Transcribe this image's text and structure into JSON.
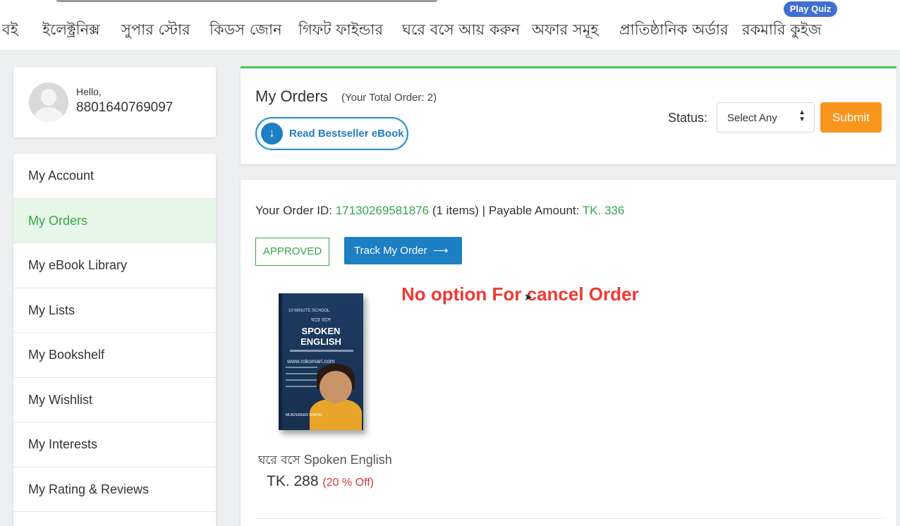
{
  "nav": {
    "items": [
      "বই",
      "ইলেক্ট্রনিক্স",
      "সুপার স্টোর",
      "কিডস জোন",
      "গিফট ফাইন্ডার",
      "ঘরে বসে আয় করুন",
      "অফার সমূহ",
      "প্রাতিষ্ঠানিক অর্ডার",
      "রকমারি কুইজ"
    ],
    "quiz_badge": "Play Quiz"
  },
  "profile": {
    "greeting": "Hello,",
    "phone": "8801640769097"
  },
  "sidebar": {
    "items": [
      {
        "label": "My Account",
        "active": false
      },
      {
        "label": "My Orders",
        "active": true
      },
      {
        "label": "My eBook Library",
        "active": false
      },
      {
        "label": "My Lists",
        "active": false
      },
      {
        "label": "My Bookshelf",
        "active": false
      },
      {
        "label": "My Wishlist",
        "active": false
      },
      {
        "label": "My Interests",
        "active": false
      },
      {
        "label": "My Rating & Reviews",
        "active": false
      }
    ]
  },
  "orders_header": {
    "title": "My Orders",
    "total": "(Your Total Order: 2)",
    "ebook_button": "Read Bestseller eBook",
    "status_label": "Status:",
    "status_value": "Select Any",
    "submit_label": "Submit"
  },
  "order": {
    "id_label": "Your Order ID:",
    "id": "17130269581876",
    "items": "(1 items) |",
    "payable_label": "Payable Amount:",
    "payable": "TK. 336",
    "status": "APPROVED",
    "track_button": "Track My Order",
    "annotation": "No option For cancel Order",
    "book": {
      "title_bn": "ঘরে বসে",
      "title_en": "Spoken English",
      "price": "TK. 288",
      "discount": "(20 % Off)",
      "cover": {
        "publisher": "10 MINUTE SCHOOL",
        "title_bn": "ঘরে বসে",
        "title_line1": "SPOKEN",
        "title_line2": "ENGLISH",
        "url": "www.rokomari.com",
        "author": "MUNZEREEN SHAHID"
      }
    }
  },
  "colors": {
    "green": "#3aa54a",
    "blue": "#1d7fc4",
    "orange": "#f7951d",
    "red": "#ee3a33"
  }
}
